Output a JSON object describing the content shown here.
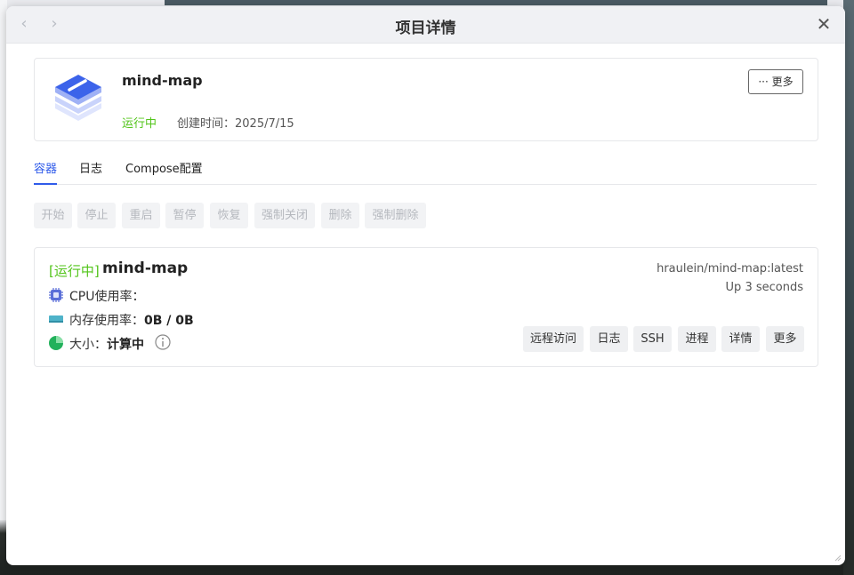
{
  "window": {
    "title": "项目详情",
    "back_label": "‹",
    "forward_label": "›",
    "close_label": "✕"
  },
  "project": {
    "name": "mind-map",
    "status": "运行中",
    "created": "创建时间：2025/7/15",
    "more_label": "··· 更多",
    "status_color": "#52c41a"
  },
  "tabs": [
    {
      "label": "容器",
      "active": true
    },
    {
      "label": "日志",
      "active": false
    },
    {
      "label": "Compose配置",
      "active": false
    }
  ],
  "actions": [
    {
      "label": "开始"
    },
    {
      "label": "停止"
    },
    {
      "label": "重启"
    },
    {
      "label": "暂停"
    },
    {
      "label": "恢复"
    },
    {
      "label": "强制关闭"
    },
    {
      "label": "删除"
    },
    {
      "label": "强制删除"
    }
  ],
  "container": {
    "status": "[运行中]",
    "name": "mind-map",
    "image": "hraulein/mind-map:latest",
    "uptime": "Up 3 seconds",
    "cpu_label": "CPU使用率：",
    "mem_label": "内存使用率：",
    "mem_value": "0B / 0B",
    "size_label": "大小：",
    "size_value": "计算中",
    "buttons": [
      {
        "label": "远程访问"
      },
      {
        "label": "日志"
      },
      {
        "label": "SSH"
      },
      {
        "label": "进程"
      },
      {
        "label": "详情"
      },
      {
        "label": "更多"
      }
    ]
  },
  "icons": {
    "logo": "stack-layers-icon",
    "cpu": "cpu-chip-icon",
    "memory": "memory-stick-icon",
    "size": "pie-chart-icon",
    "info": "info-icon"
  },
  "colors": {
    "accent": "#2f5bea",
    "running": "#52c41a"
  }
}
